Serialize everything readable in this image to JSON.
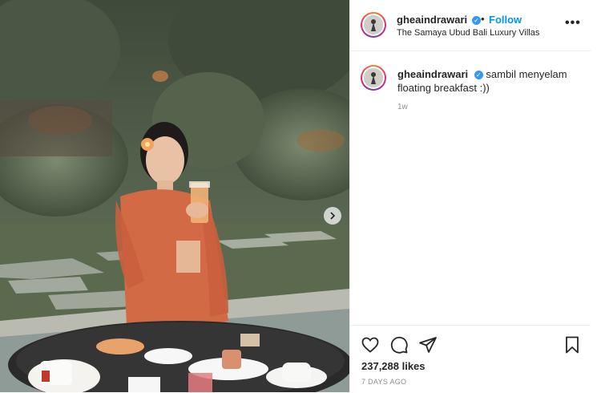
{
  "post": {
    "username": "gheaindrawari",
    "follow_label": "Follow",
    "separator": "•",
    "location": "The Samaya Ubud Bali Luxury Villas",
    "more_label": "•••",
    "caption_text": "sambil menyelam floating breakfast :))",
    "caption_time": "1w",
    "likes": "237,288 likes",
    "posted_ago": "7 DAYS AGO",
    "verified_mark": "✓"
  },
  "icons": {
    "next": "chevron-right-icon",
    "like": "heart-icon",
    "comment": "comment-icon",
    "share": "send-icon",
    "save": "bookmark-icon"
  },
  "colors": {
    "accent": "#0095f6",
    "verified": "#3897f0",
    "text": "#262626",
    "muted": "#8e8e8e"
  }
}
